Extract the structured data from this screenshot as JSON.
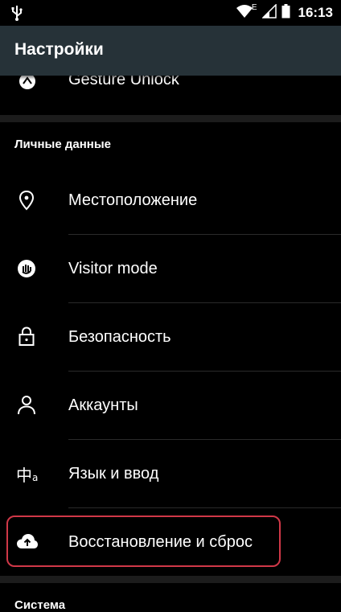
{
  "status_bar": {
    "time": "16:13",
    "network_type": "E",
    "icons": [
      "usb-icon",
      "wifi-icon",
      "signal-icon",
      "battery-icon"
    ]
  },
  "app_bar": {
    "title": "Настройки"
  },
  "items": {
    "gesture": {
      "label": "Gesture Unlock",
      "icon": "gesture-icon"
    },
    "location": {
      "label": "Местоположение",
      "icon": "location-pin-icon"
    },
    "visitor": {
      "label": "Visitor mode",
      "icon": "visitor-hand-icon"
    },
    "security": {
      "label": "Безопасность",
      "icon": "lock-icon"
    },
    "accounts": {
      "label": "Аккаунты",
      "icon": "person-icon"
    },
    "language": {
      "label": "Язык и ввод",
      "icon": "language-icon",
      "icon_glyph": "中",
      "icon_sub": "a"
    },
    "backup": {
      "label": "Восстановление и сброс",
      "icon": "cloud-upload-icon"
    }
  },
  "sections": {
    "personal": "Личные данные",
    "system": "Система"
  },
  "colors": {
    "app_bar": "#263238",
    "background": "#000000",
    "highlight_border": "#d03848"
  }
}
